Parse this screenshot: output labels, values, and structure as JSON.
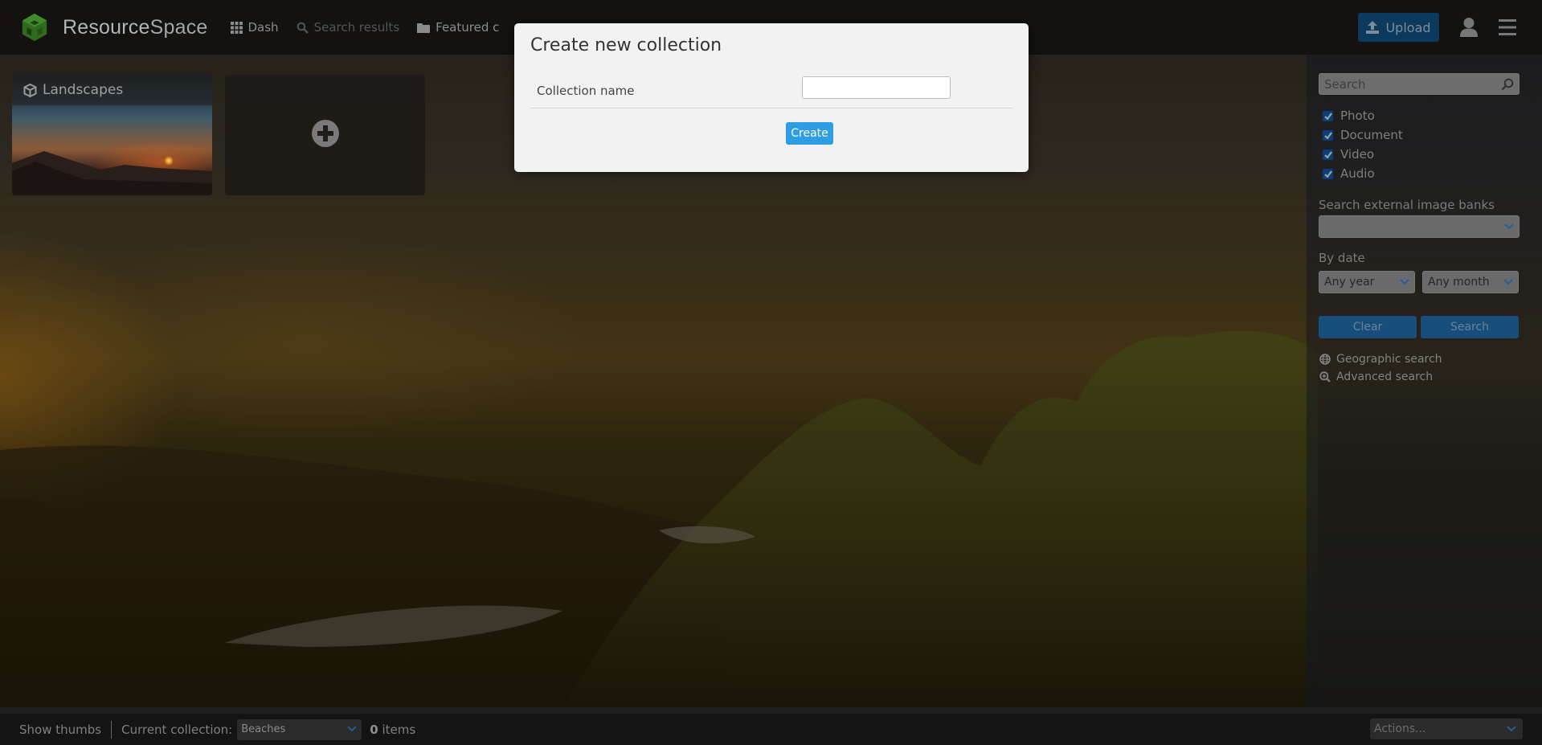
{
  "app": {
    "brand_primary": "Resource",
    "brand_secondary": "Space"
  },
  "header": {
    "nav": [
      {
        "label": "Dash",
        "icon": "grid-icon"
      },
      {
        "label": "Search results",
        "icon": "search-icon"
      },
      {
        "label": "Featured c",
        "icon": "folder-icon"
      }
    ],
    "upload_label": "Upload",
    "accent": "#0c3a5e"
  },
  "dash": {
    "tiles": [
      {
        "title": "Landscapes",
        "icon": "cube-icon"
      },
      {
        "title": "",
        "icon": "plus-circle-icon"
      }
    ]
  },
  "sidebar": {
    "search_placeholder": "Search",
    "resource_types": [
      {
        "label": "Photo",
        "checked": true
      },
      {
        "label": "Document",
        "checked": true
      },
      {
        "label": "Video",
        "checked": true
      },
      {
        "label": "Audio",
        "checked": true
      }
    ],
    "external_banks_label": "Search external image banks",
    "external_banks_value": "",
    "by_date_label": "By date",
    "year_value": "Any year",
    "month_value": "Any month",
    "clear_label": "Clear",
    "search_label": "Search",
    "links": [
      {
        "label": "Geographic search",
        "icon": "globe-icon"
      },
      {
        "label": "Advanced search",
        "icon": "zoom-in-icon"
      }
    ]
  },
  "bottom_bar": {
    "show_thumbs_label": "Show thumbs",
    "current_collection_label": "Current collection:",
    "current_collection_value": "Beaches",
    "item_count": "0",
    "items_label": "items",
    "actions_placeholder": "Actions..."
  },
  "modal": {
    "title": "Create new collection",
    "field_label": "Collection name",
    "field_value": "",
    "create_label": "Create",
    "button_color": "#2e9de4"
  }
}
